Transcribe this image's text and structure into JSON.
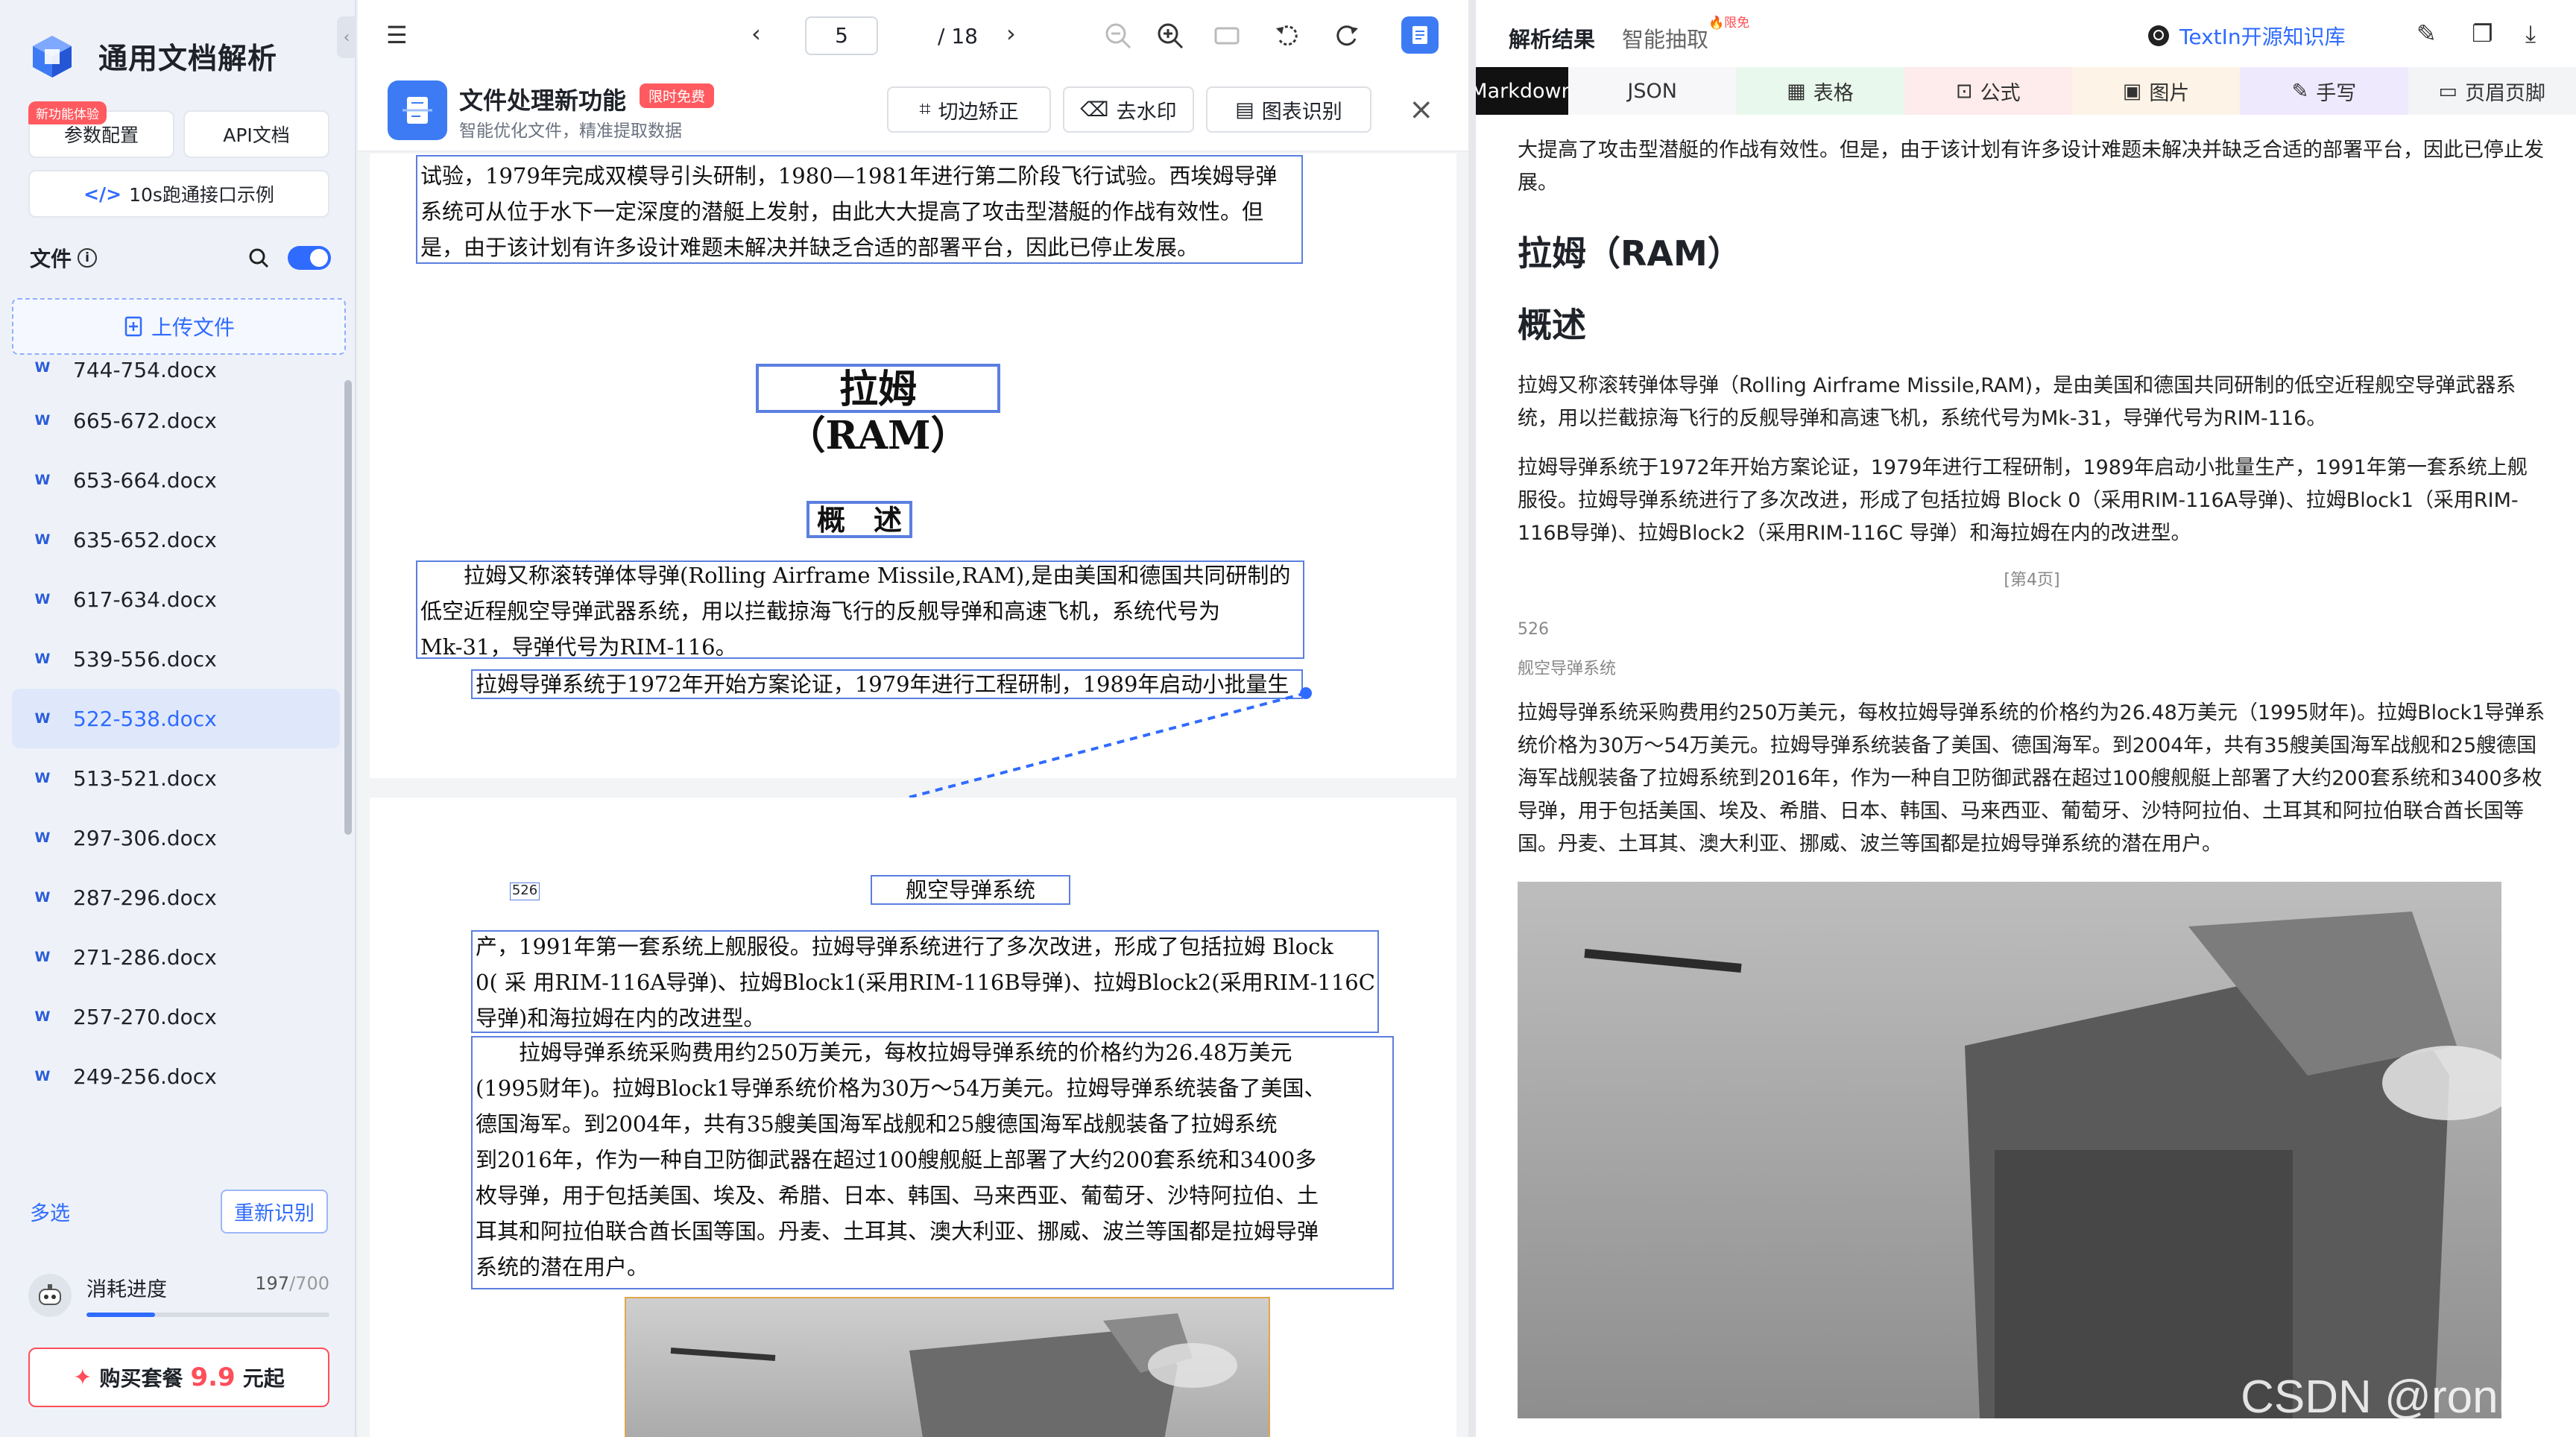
{
  "app": {
    "title": "通用文档解析",
    "new_feature_badge": "新功能体验",
    "params_button": "参数配置",
    "api_button": "API文档",
    "quickstart_button": "10s跑通接口示例",
    "files_label": "文件",
    "upload_label": "上传文件",
    "files": [
      "744-754.docx",
      "665-672.docx",
      "653-664.docx",
      "635-652.docx",
      "617-634.docx",
      "539-556.docx",
      "522-538.docx",
      "513-521.docx",
      "297-306.docx",
      "287-296.docx",
      "271-286.docx",
      "257-270.docx",
      "249-256.docx"
    ],
    "active_file": "522-538.docx",
    "multi_select": "多选",
    "reparse": "重新识别",
    "usage_label": "消耗进度",
    "usage_used": "197",
    "usage_total": "/700",
    "usage_fraction": 0.281,
    "buy_prefix": "购买套餐",
    "buy_price": "9.9",
    "buy_suffix": "元起",
    "accent": "#2f6bff"
  },
  "viewer": {
    "page_current": "5",
    "page_total": "/  18",
    "feature_title": "文件处理新功能",
    "feature_badge": "限时免费",
    "feature_subtitle": "智能优化文件，精准提取数据",
    "btn_crop": "切边矫正",
    "btn_watermark": "去水印",
    "btn_chart": "图表识别"
  },
  "document": {
    "top_para": [
      "试验，1979年完成双模导引头研制，1980—1981年进行第二阶段飞行试验。西埃姆导弹",
      "系统可从位于水下一定深度的潜艇上发射，由此大大提高了攻击型潜艇的作战有效性。但",
      "是，由于该计划有许多设计难题未解决并缺乏合适的部署平台，因此已停止发展。"
    ],
    "heading": "拉姆（RAM）",
    "subheading": "概　述",
    "para1": [
      "　　拉姆又称滚转弹体导弹(Rolling Airframe Missile,RAM),是由美国和德国共同研制的",
      "低空近程舰空导弹武器系统，用以拦截掠海飞行的反舰导弹和高速飞机，系统代号为",
      "Mk-31，导弹代号为RIM-116。"
    ],
    "para2": "拉姆导弹系统于1972年开始方案论证，1979年进行工程研制，1989年启动小批量生",
    "page_number": "526",
    "page_header": "舰空导弹系统",
    "para3": [
      "产，1991年第一套系统上舰服役。拉姆导弹系统进行了多次改进，形成了包括拉姆 Block",
      "0( 采 用RIM-116A导弹)、拉姆Block1(采用RIM-116B导弹)、拉姆Block2(采用RIM-116C",
      "导弹)和海拉姆在内的改进型。"
    ],
    "para4": [
      "　　拉姆导弹系统采购费用约250万美元，每枚拉姆导弹系统的价格约为26.48万美元",
      "(1995财年)。拉姆Block1导弹系统价格为30万～54万美元。拉姆导弹系统装备了美国、",
      "德国海军。到2004年，共有35艘美国海军战舰和25艘德国海军战舰装备了拉姆系统",
      "到2016年，作为一种自卫防御武器在超过100艘舰艇上部署了大约200套系统和3400多",
      "枚导弹，用于包括美国、埃及、希腊、日本、韩国、马来西亚、葡萄牙、沙特阿拉伯、土",
      "耳其和阿拉伯联合酋长国等国。丹麦、土耳其、澳大利亚、挪威、波兰等国都是拉姆导弹",
      "系统的潜在用户。"
    ]
  },
  "result": {
    "tab_main": "解析结果",
    "tab_smart": "智能抽取",
    "hot_badge": "限免",
    "github_link": "TextIn开源知识库",
    "format_tabs": [
      "Markdown",
      "JSON",
      "表格",
      "公式",
      "图片",
      "手写",
      "页眉页脚"
    ],
    "active_format": "Markdown",
    "p0": "大提高了攻击型潜艇的作战有效性。但是，由于该计划有许多设计难题未解决并缺乏合适的部署平台，因此已停止发展。",
    "h1": "拉姆（RAM）",
    "h2": "概述",
    "p1": "拉姆又称滚转弹体导弹（Rolling Airframe Missile,RAM)，是由美国和德国共同研制的低空近程舰空导弹武器系统，用以拦截掠海飞行的反舰导弹和高速飞机，系统代号为Mk-31，导弹代号为RIM-116。",
    "p2": "拉姆导弹系统于1972年开始方案论证，1979年进行工程研制，1989年启动小批量生产，1991年第一套系统上舰服役。拉姆导弹系统进行了多次改进，形成了包括拉姆 Block 0（采用RIM-116A导弹)、拉姆Block1（采用RIM-116B导弹)、拉姆Block2（采用RIM-116C 导弹）和海拉姆在内的改进型。",
    "page_marker": "[第4页]",
    "page_no": "526",
    "page_header": "舰空导弹系统",
    "p3": "拉姆导弹系统采购费用约250万美元，每枚拉姆导弹系统的价格约为26.48万美元（1995财年)。拉姆Block1导弹系统价格为30万～54万美元。拉姆导弹系统装备了美国、德国海军。到2004年，共有35艘美国海军战舰和25艘德国海军战舰装备了拉姆系统到2016年，作为一种自卫防御武器在超过100艘舰艇上部署了大约200套系统和3400多枚导弹，用于包括美国、埃及、希腊、日本、韩国、马来西亚、葡萄牙、沙特阿拉伯、土耳其和阿拉伯联合酋长国等国。丹麦、土耳其、澳大利亚、挪威、波兰等国都是拉姆导弹系统的潜在用户。",
    "watermark": "CSDN @ronlym"
  }
}
